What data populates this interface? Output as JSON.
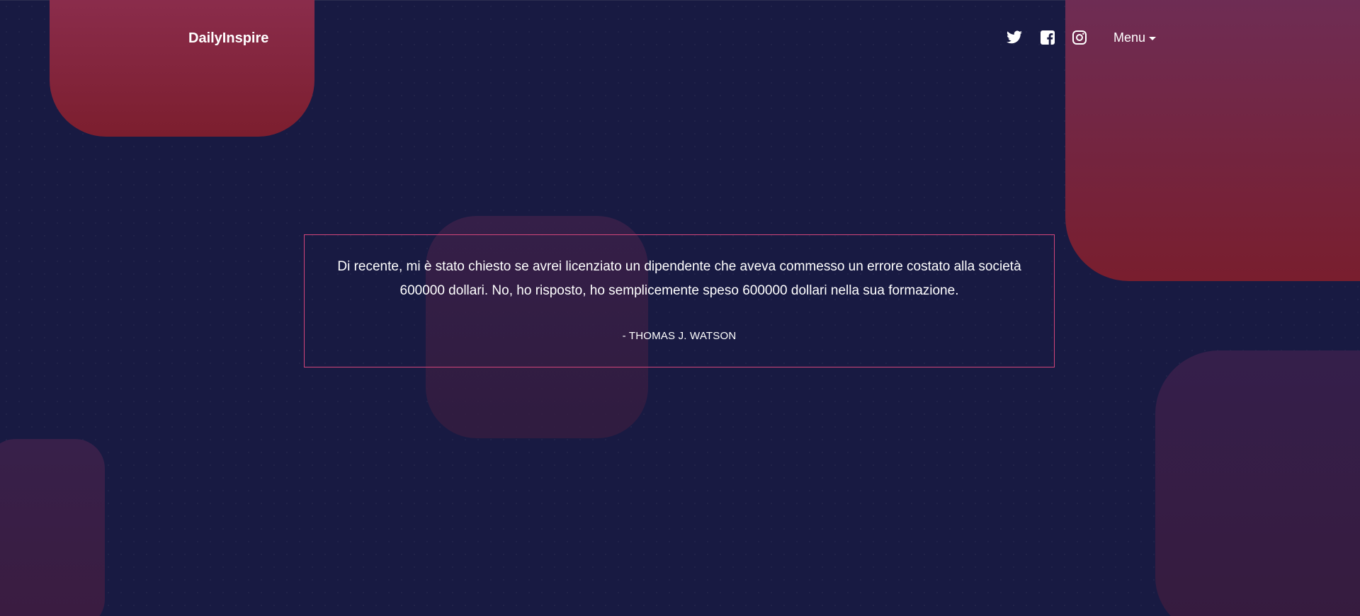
{
  "header": {
    "brand": "DailyInspire",
    "social": [
      {
        "icon": "twitter-icon"
      },
      {
        "icon": "facebook-icon"
      },
      {
        "icon": "instagram-icon"
      }
    ],
    "menu_label": "Menu"
  },
  "quote": {
    "text": "Di recente, mi è stato chiesto se avrei licenziato un dipendente che aveva commesso un errore costato alla società 600000 dollari. No, ho risposto, ho semplicemente speso 600000 dollari nella sua formazione.",
    "author": "- THOMAS J. WATSON"
  },
  "colors": {
    "background": "#181a42",
    "quote_border": "#d2457a",
    "shape_red": "#7c1e2e",
    "shape_purple": "#351f4b",
    "text": "#ffffff"
  }
}
